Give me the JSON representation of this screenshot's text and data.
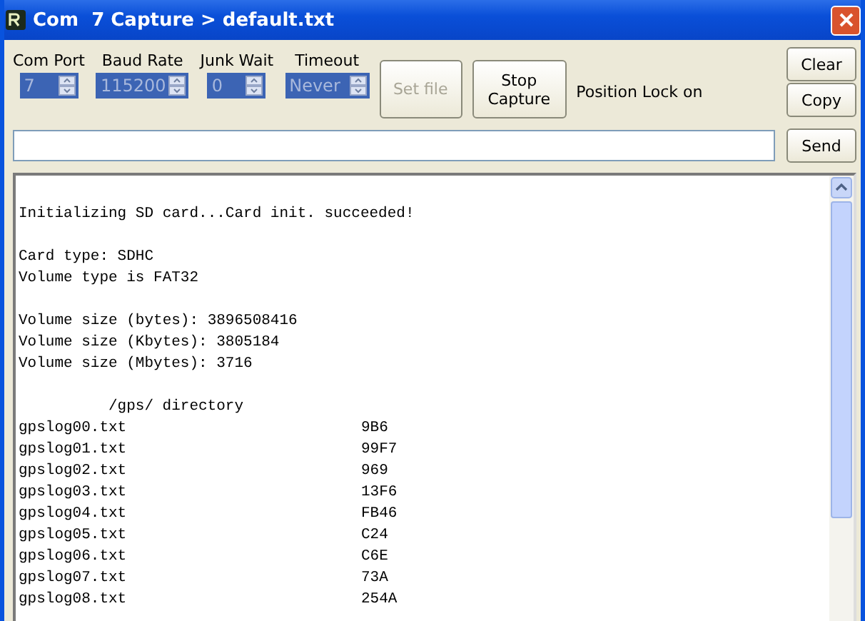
{
  "window": {
    "title": "Com  7 Capture > default.txt"
  },
  "settings": [
    {
      "label": "Com Port",
      "value": "7",
      "disabled": true
    },
    {
      "label": "Baud Rate",
      "value": "115200",
      "disabled": true
    },
    {
      "label": "Junk Wait",
      "value": "0",
      "disabled": true
    },
    {
      "label": "Timeout",
      "value": "Never",
      "disabled": true
    }
  ],
  "buttons": [
    {
      "label": "Set file",
      "disabled": true
    },
    {
      "label": "Stop Capture",
      "disabled": false
    }
  ],
  "status": "Position Lock on",
  "side_buttons": [
    "Clear",
    "Copy"
  ],
  "send_button": "Send",
  "log": [
    {
      "kind": "blank"
    },
    {
      "kind": "text",
      "text": "Initializing SD card...Card init. succeeded!"
    },
    {
      "kind": "blank"
    },
    {
      "kind": "text",
      "text": "Card type: SDHC"
    },
    {
      "kind": "text",
      "text": "Volume type is FAT32"
    },
    {
      "kind": "blank"
    },
    {
      "kind": "text",
      "text": "Volume size (bytes): 3896508416"
    },
    {
      "kind": "text",
      "text": "Volume size (Kbytes): 3805184"
    },
    {
      "kind": "text",
      "text": "Volume size (Mbytes): 3716"
    },
    {
      "kind": "blank"
    },
    {
      "kind": "heading",
      "text": "/gps/ directory"
    },
    {
      "kind": "file",
      "name": "gpslog00.txt",
      "size": "9B6"
    },
    {
      "kind": "file",
      "name": "gpslog01.txt",
      "size": "99F7"
    },
    {
      "kind": "file",
      "name": "gpslog02.txt",
      "size": "969"
    },
    {
      "kind": "file",
      "name": "gpslog03.txt",
      "size": "13F6"
    },
    {
      "kind": "file",
      "name": "gpslog04.txt",
      "size": "FB46"
    },
    {
      "kind": "file",
      "name": "gpslog05.txt",
      "size": "C24"
    },
    {
      "kind": "file",
      "name": "gpslog06.txt",
      "size": "C6E"
    },
    {
      "kind": "file",
      "name": "gpslog07.txt",
      "size": "73A"
    },
    {
      "kind": "file",
      "name": "gpslog08.txt",
      "size": "254A"
    }
  ]
}
